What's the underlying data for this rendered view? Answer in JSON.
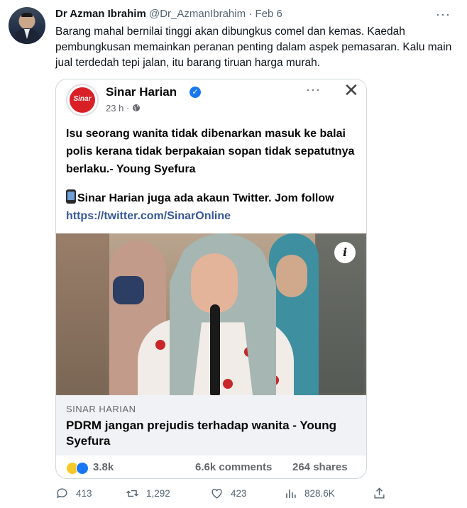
{
  "tweet": {
    "author_name": "Dr Azman Ibrahim",
    "author_handle": "@Dr_AzmanIbrahim",
    "separator": "·",
    "date": "Feb 6",
    "more": "···",
    "text": "Barang mahal bernilai tinggi akan dibungkus comel dan kemas. Kaedah pembungkusan memainkan peranan penting dalam aspek pemasaran. Kalu main jual terdedah tepi jalan, itu barang tiruan harga murah."
  },
  "embedded_post": {
    "page_logo_text": "Sinar",
    "page_name": "Sinar Harian",
    "verified_mark": "✓",
    "time": "23 h · ",
    "more": "···",
    "close": "✕",
    "body_text": "Isu seorang wanita tidak dibenarkan masuk ke balai polis kerana tidak berpakaian sopan tidak sepatutnya berlaku.- Young Syefura",
    "promo_text": "Sinar Harian juga ada akaun Twitter. Jom follow ",
    "promo_link": "https://twitter.com/SinarOnline",
    "info_button": "i",
    "link_source": "SINAR HARIAN",
    "link_title": "PDRM jangan prejudis terhadap wanita - Young Syefura",
    "reactions_count": "3.8k",
    "comments": "6.6k comments",
    "shares": "264 shares"
  },
  "actions": {
    "replies": "413",
    "retweets": "1,292",
    "likes": "423",
    "views": "828.6K"
  },
  "icons": {
    "reply": "reply-icon",
    "retweet": "retweet-icon",
    "like": "heart-icon",
    "views": "views-icon",
    "share": "share-icon",
    "globe": "globe-icon",
    "phone": "phone-icon"
  },
  "colors": {
    "text": "#0f1419",
    "muted": "#536471",
    "fb_link": "#385898",
    "brand_red": "#d92027",
    "verified_blue": "#1877f2"
  }
}
